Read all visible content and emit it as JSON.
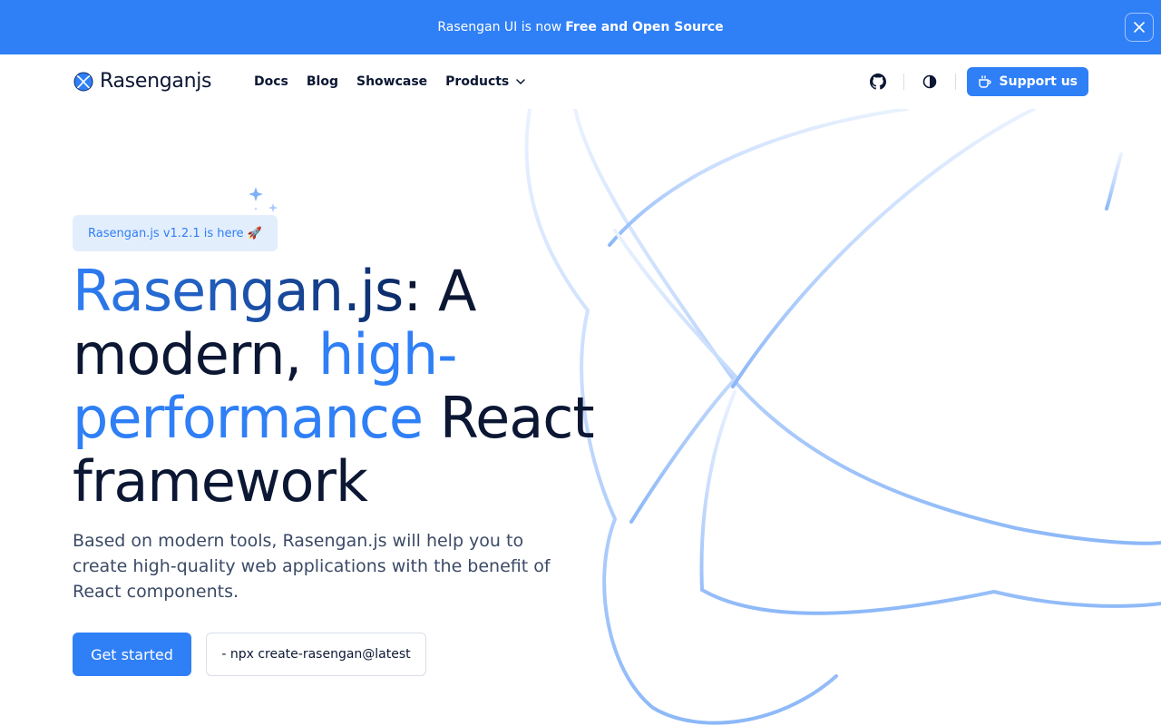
{
  "banner": {
    "text": "Rasengan UI is now",
    "highlight": "Free and Open Source",
    "close_icon": "close-icon"
  },
  "nav": {
    "brand": "Rasenganjs",
    "links": [
      "Docs",
      "Blog",
      "Showcase",
      "Products"
    ],
    "products_icon": "chevron-down-icon",
    "github_icon": "github-icon",
    "theme_icon": "contrast-icon",
    "support_label": "Support us",
    "support_icon": "coffee-icon"
  },
  "hero": {
    "badge": "Rasengan.js v1.2.1 is here 🚀",
    "title_part1": "Rasengan.js",
    "title_part2": ": A modern, ",
    "title_part3": "high-performance",
    "title_part4": " React framework",
    "description": "Based on modern tools, Rasengan.js will help you to create high-quality web applications with the benefit of React components.",
    "cta_primary": "Get started",
    "cta_command": "- npx create-rasengan@latest"
  },
  "colors": {
    "accent": "#2f7ff6",
    "text": "#0b1733",
    "muted": "#3b4a66",
    "badge_bg": "#e3eefd"
  }
}
